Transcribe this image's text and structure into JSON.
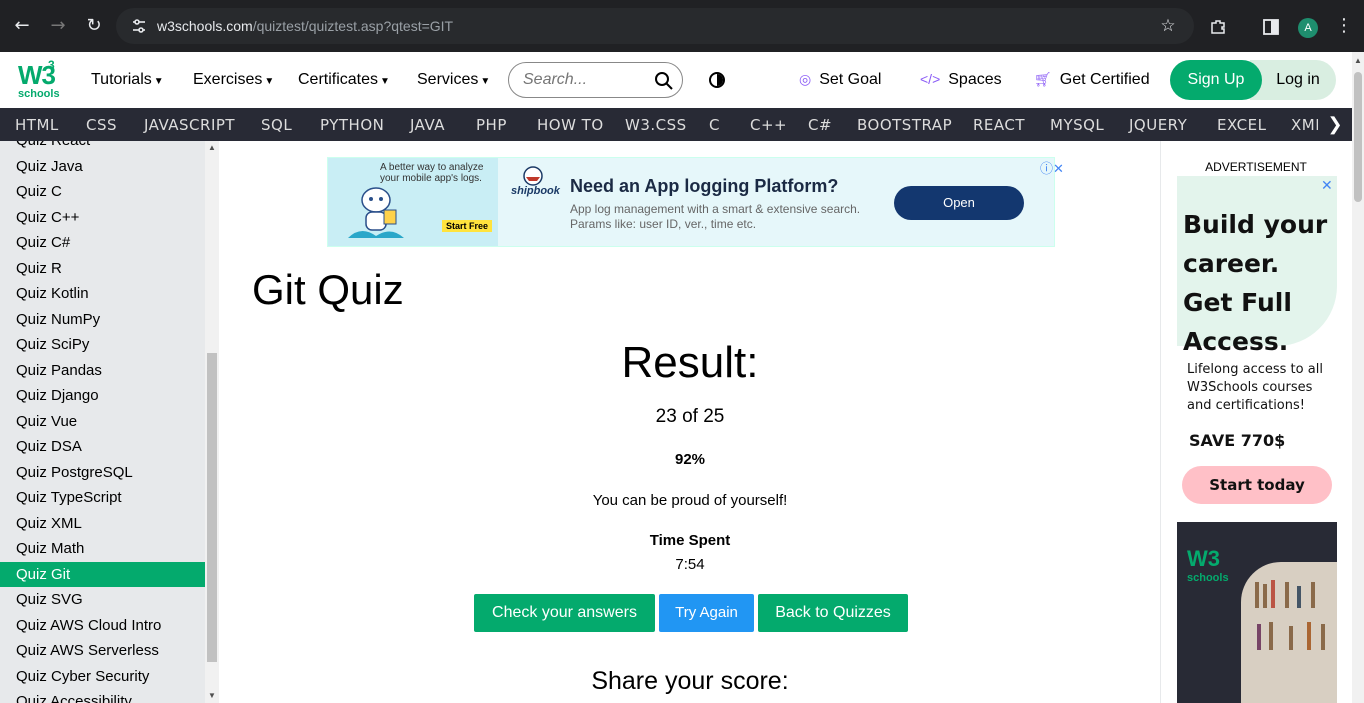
{
  "browser": {
    "url_host": "w3schools.com",
    "url_path": "/quiztest/quiztest.asp?qtest=GIT",
    "avatar_letter": "A"
  },
  "topnav": {
    "logo_main": "W3",
    "logo_sup": "3",
    "logo_sub": "schools",
    "menus": [
      "Tutorials",
      "Exercises",
      "Certificates",
      "Services"
    ],
    "search_placeholder": "Search...",
    "set_goal": "Set Goal",
    "spaces": "Spaces",
    "get_certified": "Get Certified",
    "sign_up": "Sign Up",
    "log_in": "Log in"
  },
  "subnav": {
    "items": [
      "HTML",
      "CSS",
      "JAVASCRIPT",
      "SQL",
      "PYTHON",
      "JAVA",
      "PHP",
      "HOW TO",
      "W3.CSS",
      "C",
      "C++",
      "C#",
      "BOOTSTRAP",
      "REACT",
      "MYSQL",
      "JQUERY",
      "EXCEL",
      "XML"
    ],
    "arrow": "❯"
  },
  "sidebar": {
    "items": [
      "Quiz React",
      "Quiz Java",
      "Quiz C",
      "Quiz C++",
      "Quiz C#",
      "Quiz R",
      "Quiz Kotlin",
      "Quiz NumPy",
      "Quiz SciPy",
      "Quiz Pandas",
      "Quiz Django",
      "Quiz Vue",
      "Quiz DSA",
      "Quiz PostgreSQL",
      "Quiz TypeScript",
      "Quiz XML",
      "Quiz Math",
      "Quiz Git",
      "Quiz SVG",
      "Quiz AWS Cloud Intro",
      "Quiz AWS Serverless",
      "Quiz Cyber Security",
      "Quiz Accessibility"
    ],
    "active": "Quiz Git"
  },
  "ad_banner": {
    "tagline": "A better way to analyze your mobile app's logs.",
    "start_free": "Start Free",
    "brand": "shipbook",
    "headline": "Need an App logging Platform?",
    "description": "App log management with a smart & extensive search. Params like: user ID, ver., time etc.",
    "open": "Open"
  },
  "main": {
    "title": "Git Quiz",
    "result_title": "Result:",
    "score": "23 of 25",
    "percent": "92%",
    "message": "You can be proud of yourself!",
    "time_label": "Time Spent",
    "time_value": "7:54",
    "buttons": {
      "check": "Check your answers",
      "try_again": "Try Again",
      "back": "Back to Quizzes"
    },
    "share_title": "Share your score:"
  },
  "right_ad": {
    "label": "ADVERTISEMENT",
    "headline": "Build your career. Get Full Access.",
    "sub": "Lifelong access to all W3Schools courses and certifications!",
    "save": "SAVE 770$",
    "cta": "Start today",
    "img_logo": "W3",
    "img_sub": "schools"
  },
  "colors": {
    "brand_green": "#04aa6d",
    "subnav_bg": "#282a35",
    "try_again_blue": "#2196f3"
  }
}
